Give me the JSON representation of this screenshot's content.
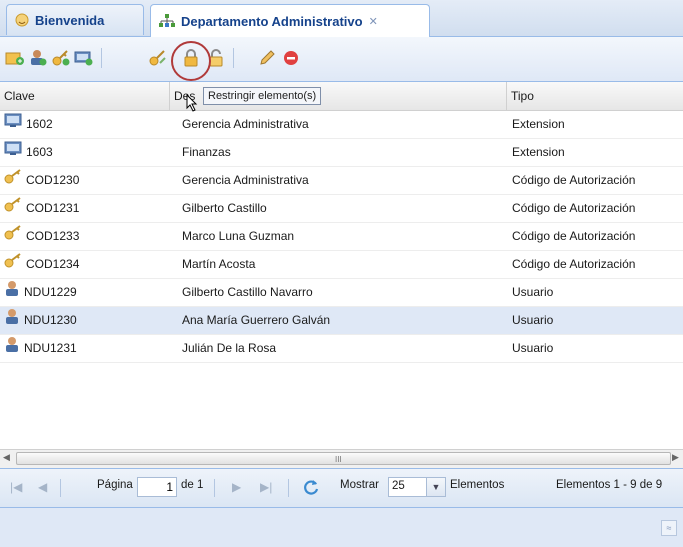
{
  "tabs": [
    {
      "label": "Bienvenida"
    },
    {
      "label": "Departamento Administrativo"
    }
  ],
  "tooltip": "Restringir elemento(s)",
  "columns": [
    "Clave",
    "Des",
    "Tipo"
  ],
  "rows": [
    {
      "icon": "extension-icon",
      "clave": "1602",
      "desc": "Gerencia Administrativa",
      "tipo": "Extension"
    },
    {
      "icon": "extension-icon",
      "clave": "1603",
      "desc": "Finanzas",
      "tipo": "Extension"
    },
    {
      "icon": "key-icon",
      "clave": "COD1230",
      "desc": "Gerencia Administrativa",
      "tipo": "Código de Autorización"
    },
    {
      "icon": "key-icon",
      "clave": "COD1231",
      "desc": "Gilberto Castillo",
      "tipo": "Código de Autorización"
    },
    {
      "icon": "key-icon",
      "clave": "COD1233",
      "desc": "Marco Luna Guzman",
      "tipo": "Código de Autorización"
    },
    {
      "icon": "key-icon",
      "clave": "COD1234",
      "desc": "Martín Acosta",
      "tipo": "Código de Autorización"
    },
    {
      "icon": "user-icon",
      "clave": "NDU1229",
      "desc": "Gilberto Castillo Navarro",
      "tipo": "Usuario"
    },
    {
      "icon": "user-icon",
      "clave": "NDU1230",
      "desc": "Ana María Guerrero Galván",
      "tipo": "Usuario",
      "selected": true
    },
    {
      "icon": "user-icon",
      "clave": "NDU1231",
      "desc": "Julián De la Rosa",
      "tipo": "Usuario"
    }
  ],
  "scrollbar_grip": "III",
  "pager": {
    "page_label": "Página",
    "page_value": "1",
    "of_label": "de 1",
    "show_label": "Mostrar",
    "page_size": "25",
    "elements_label": "Elementos",
    "range_label": "Elementos 1 - 9 de 9"
  },
  "colors": {
    "accent": "#15428b",
    "selected_row": "#dfe8f6",
    "highlight_circle": "#b03a3a"
  }
}
